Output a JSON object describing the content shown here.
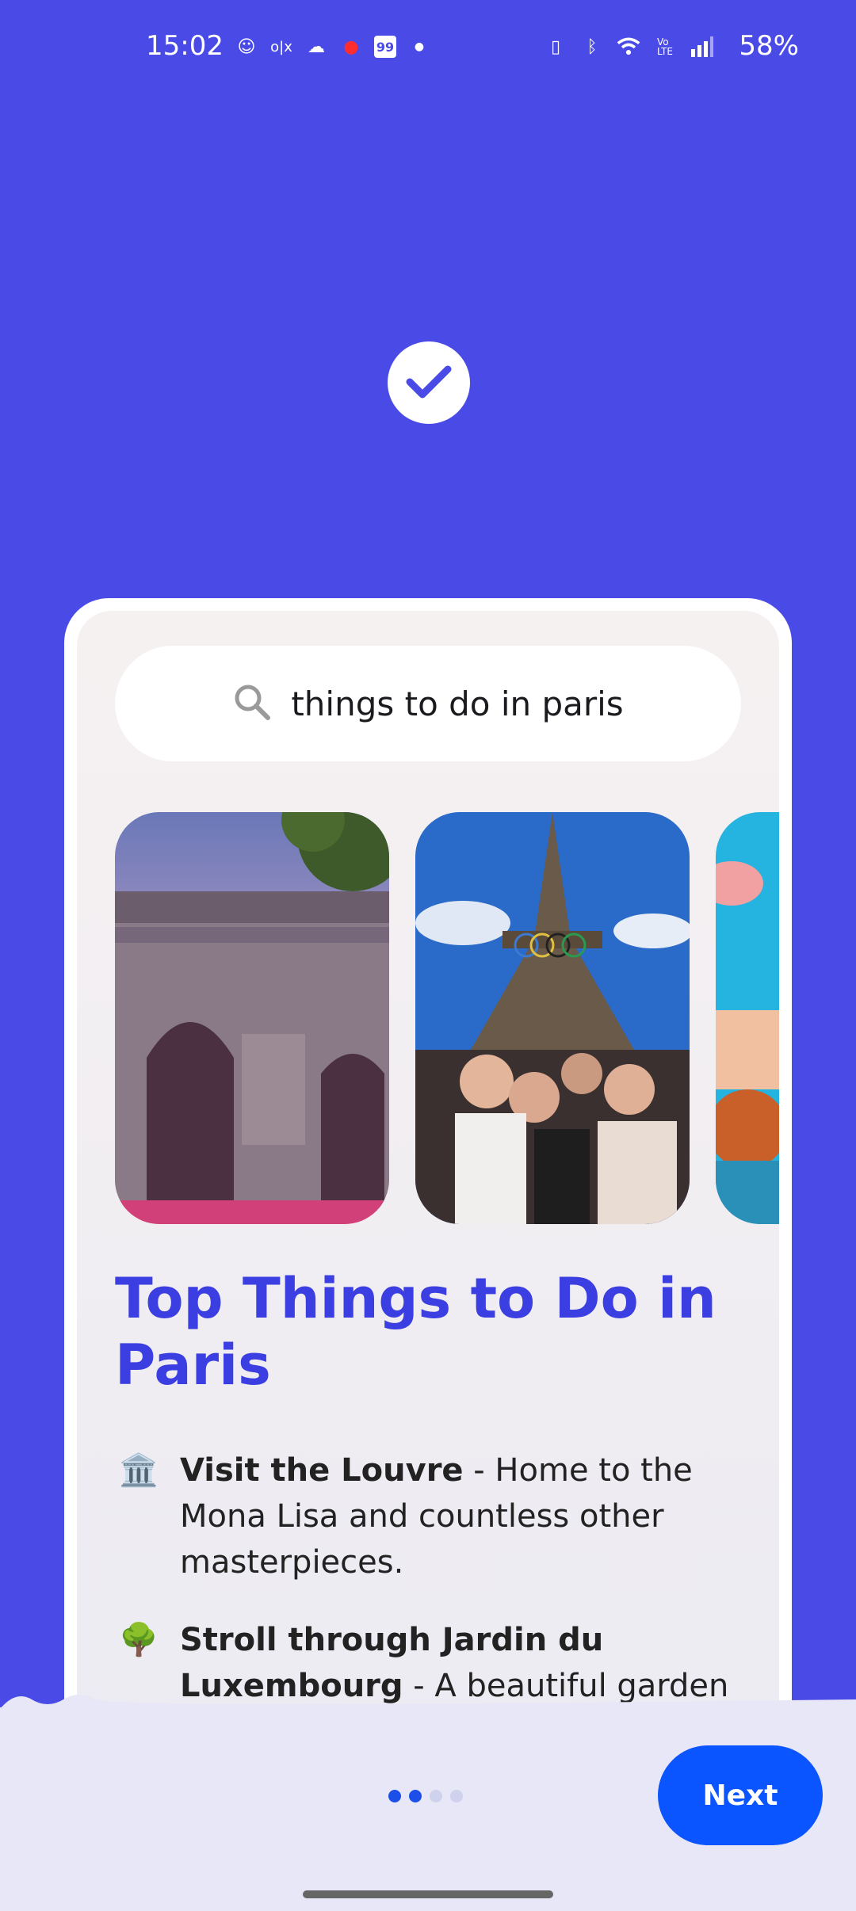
{
  "status_bar": {
    "time": "15:02",
    "battery": "58%",
    "left_icons": [
      "face-icon",
      "ox-icon",
      "cloud-icon",
      "airtel-icon",
      "badge-99-icon",
      "dot-icon"
    ],
    "badge_text": "99",
    "right_icons": [
      "vibrate-icon",
      "bluetooth-icon",
      "wifi-icon",
      "volte-icon",
      "signal-icon"
    ]
  },
  "header": {
    "check_icon": "check-icon"
  },
  "card": {
    "search_query": "things to do in paris",
    "search_icon": "search-icon",
    "images": [
      {
        "name": "arc-de-triomphe-photo"
      },
      {
        "name": "eiffel-tower-group-photo"
      },
      {
        "name": "seine-river-photo"
      }
    ],
    "title": "Top Things to Do in Paris",
    "items": [
      {
        "emoji": "🏛️",
        "bold": "Visit the Louvre",
        "text": " - Home to the Mona Lisa and countless other masterpieces."
      },
      {
        "emoji": "🌳",
        "bold": "Stroll through Jardin du Luxembourg",
        "text": " - A beautiful garden"
      }
    ]
  },
  "footer": {
    "page_count": 4,
    "current_page": 2,
    "next_label": "Next"
  },
  "colors": {
    "background": "#4a4be6",
    "accent": "#0a55ff",
    "title": "#3b3ee0",
    "sheet": "#e7e7f8"
  }
}
